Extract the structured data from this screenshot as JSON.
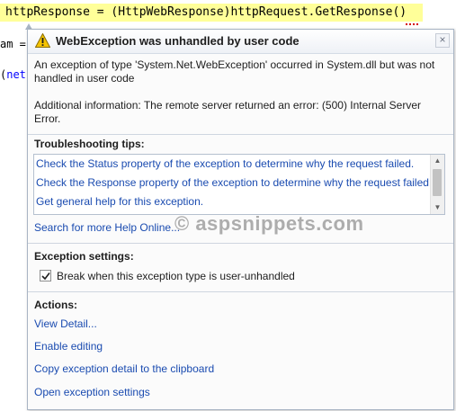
{
  "editor": {
    "code_line": "httpResponse = (HttpWebResponse)httpRequest.GetResponse()",
    "fragment_1_prefix": "am =",
    "fragment_2_prefix": "(",
    "fragment_2_keyword": "net"
  },
  "helper": {
    "title": "WebException was unhandled by user code",
    "close_glyph": "×",
    "message": "An exception of type 'System.Net.WebException' occurred in System.dll but was not handled in user code",
    "additional_info": "Additional information: The remote server returned an error: (500) Internal Server Error.",
    "troubleshooting": {
      "title": "Troubleshooting tips:",
      "tips": [
        "Check the Status property of the exception to determine why the request failed.",
        "Check the Response property of the exception to determine why the request failed.",
        "Get general help for this exception."
      ],
      "search_link": "Search for more Help Online..."
    },
    "exception_settings": {
      "title": "Exception settings:",
      "checkbox_label": "Break when this exception type is user-unhandled",
      "checked": true
    },
    "actions": {
      "title": "Actions:",
      "items": [
        "View Detail...",
        "Enable editing",
        "Copy exception detail to the clipboard",
        "Open exception settings"
      ]
    }
  },
  "watermark": "© aspsnippets.com",
  "colors": {
    "link": "#1a4bb0",
    "code_highlight": "#ffff99",
    "warning": "#f5c400"
  }
}
